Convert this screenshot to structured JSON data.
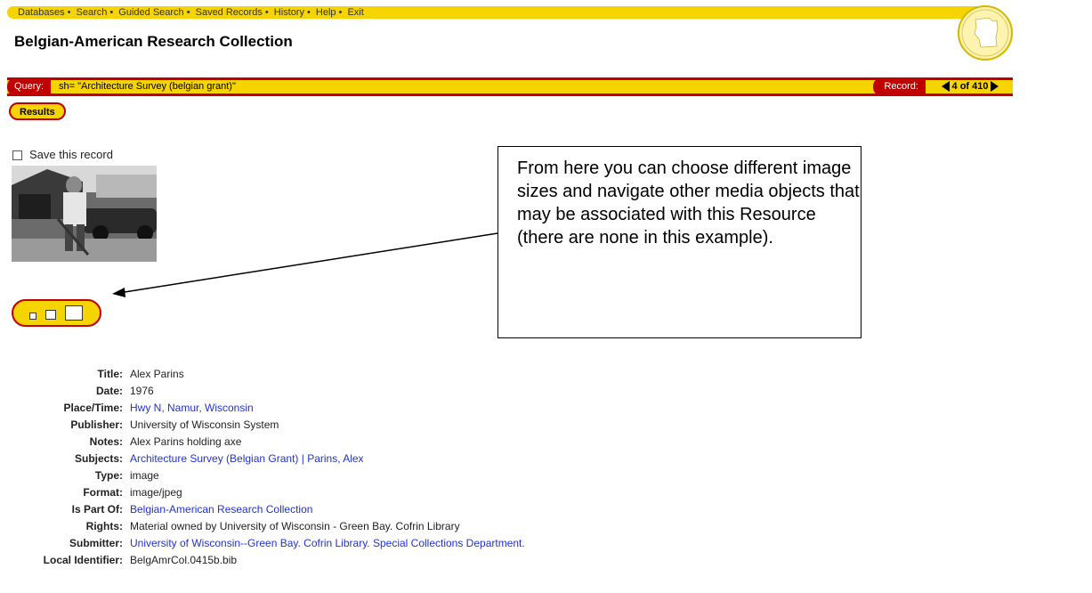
{
  "topnav": {
    "items": [
      "Databases",
      "Search",
      "Guided Search",
      "Saved Records",
      "History",
      "Help",
      "Exit"
    ]
  },
  "page_title": "Belgian-American Research Collection",
  "query": {
    "label": "Query:",
    "text": "sh= \"Architecture Survey (belgian grant)\"",
    "record_label": "Record:",
    "record_position": "4 of 410"
  },
  "results_label": "Results",
  "save_label": "Save this record",
  "callout_text": "From here you can choose different image sizes and navigate other media objects that may be associated with this Resource (there are none in this example).",
  "metadata": [
    {
      "label": "Title:",
      "value": "Alex Parins",
      "link": false
    },
    {
      "label": "Date:",
      "value": "1976",
      "link": false
    },
    {
      "label": "Place/Time:",
      "value": "Hwy N, Namur, Wisconsin",
      "link": true
    },
    {
      "label": "Publisher:",
      "value": "University of Wisconsin System",
      "link": false
    },
    {
      "label": "Notes:",
      "value": "Alex Parins holding axe",
      "link": false
    },
    {
      "label": "Subjects:",
      "value": "Architecture Survey (Belgian Grant) | Parins, Alex",
      "link": true
    },
    {
      "label": "Type:",
      "value": "image",
      "link": false
    },
    {
      "label": "Format:",
      "value": "image/jpeg",
      "link": false
    },
    {
      "label": "Is Part Of:",
      "value": "Belgian-American Research Collection",
      "link": true
    },
    {
      "label": "Rights:",
      "value": "Material owned by University of Wisconsin - Green Bay. Cofrin Library",
      "link": false
    },
    {
      "label": "Submitter:",
      "value": "University of Wisconsin--Green Bay. Cofrin Library. Special Collections Department.",
      "link": true
    },
    {
      "label": "Local Identifier:",
      "value": "BelgAmrCol.0415b.bib",
      "link": false
    }
  ],
  "colors": {
    "accent_yellow": "#f5d400",
    "accent_red": "#c00000",
    "link": "#2233cc"
  }
}
